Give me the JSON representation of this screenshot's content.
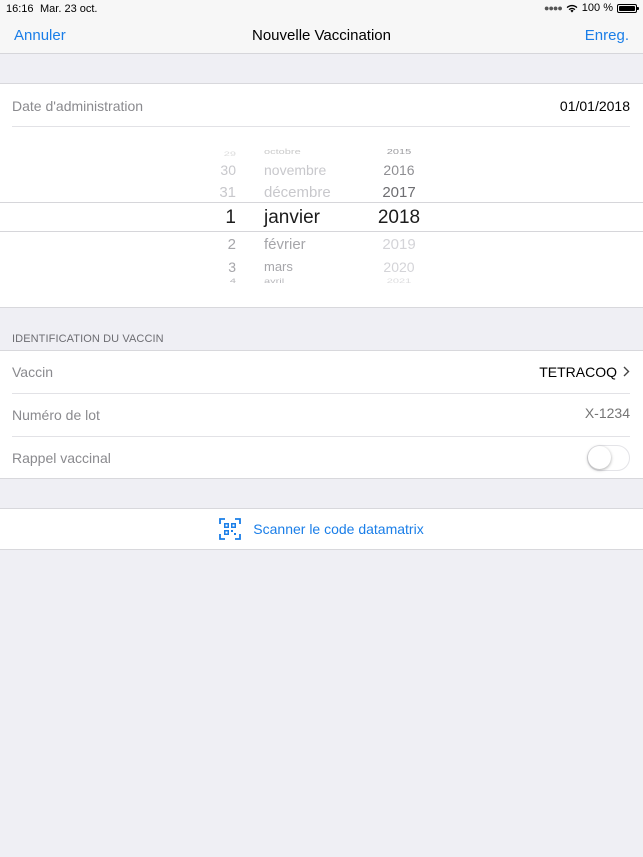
{
  "status": {
    "time": "16:16",
    "date": "Mar. 23 oct.",
    "battery": "100 %",
    "signal_icon": "signal-dots-icon",
    "wifi_icon": "wifi-icon",
    "battery_icon": "battery-icon"
  },
  "nav": {
    "cancel": "Annuler",
    "title": "Nouvelle Vaccination",
    "save": "Enreg."
  },
  "date_row": {
    "label": "Date d'administration",
    "value": "01/01/2018"
  },
  "picker": {
    "days": [
      "29",
      "30",
      "31",
      "1",
      "2",
      "3",
      "4"
    ],
    "months": [
      "octobre",
      "novembre",
      "décembre",
      "janvier",
      "février",
      "mars",
      "avril"
    ],
    "years": [
      "2015",
      "2016",
      "2017",
      "2018",
      "2019",
      "2020",
      "2021"
    ],
    "selected": {
      "day": "1",
      "month": "janvier",
      "year": "2018"
    }
  },
  "vaccine_section": {
    "header": "IDENTIFICATION DU VACCIN",
    "vaccine_label": "Vaccin",
    "vaccine_value": "TETRACOQ",
    "lot_label": "Numéro de lot",
    "lot_placeholder": "X-1234",
    "booster_label": "Rappel vaccinal",
    "booster_on": false
  },
  "scan": {
    "label": "Scanner le code datamatrix",
    "icon": "qr-scan-icon"
  },
  "colors": {
    "accent": "#1a7ee8",
    "background": "#efeff4"
  }
}
